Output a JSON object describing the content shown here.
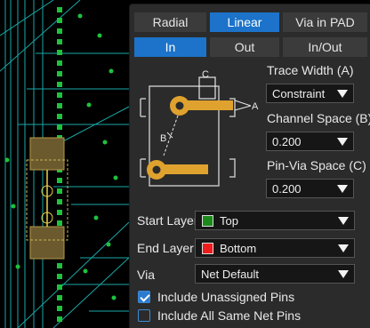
{
  "routing_mode": {
    "options": [
      "Radial",
      "Linear",
      "Via in PAD"
    ],
    "selected": "Linear"
  },
  "direction": {
    "options": [
      "In",
      "Out",
      "In/Out"
    ],
    "selected": "In"
  },
  "diagram_labels": {
    "a": "A",
    "b": "B",
    "c": "C"
  },
  "trace_width": {
    "label": "Trace Width (A)",
    "value": "Constraint"
  },
  "channel_space": {
    "label": "Channel Space (B)",
    "value": "0.200"
  },
  "pin_via_space": {
    "label": "Pin-Via Space (C)",
    "value": "0.200"
  },
  "start_layer": {
    "label": "Start Layer",
    "value": "Top",
    "swatch_color": "#1a8a1a"
  },
  "end_layer": {
    "label": "End Layer",
    "value": "Bottom",
    "swatch_color": "#ee1c1c"
  },
  "via": {
    "label": "Via",
    "value": "Net Default"
  },
  "include_unassigned": {
    "label": "Include Unassigned Pins",
    "checked": true
  },
  "include_same_net": {
    "label": "Include All Same Net Pins",
    "checked": false
  },
  "colors": {
    "accent": "#1c73c9",
    "pad_gold": "#e0a22e",
    "pcb_trace": "#1aa7a7",
    "pcb_pad": "#1ec23c"
  }
}
